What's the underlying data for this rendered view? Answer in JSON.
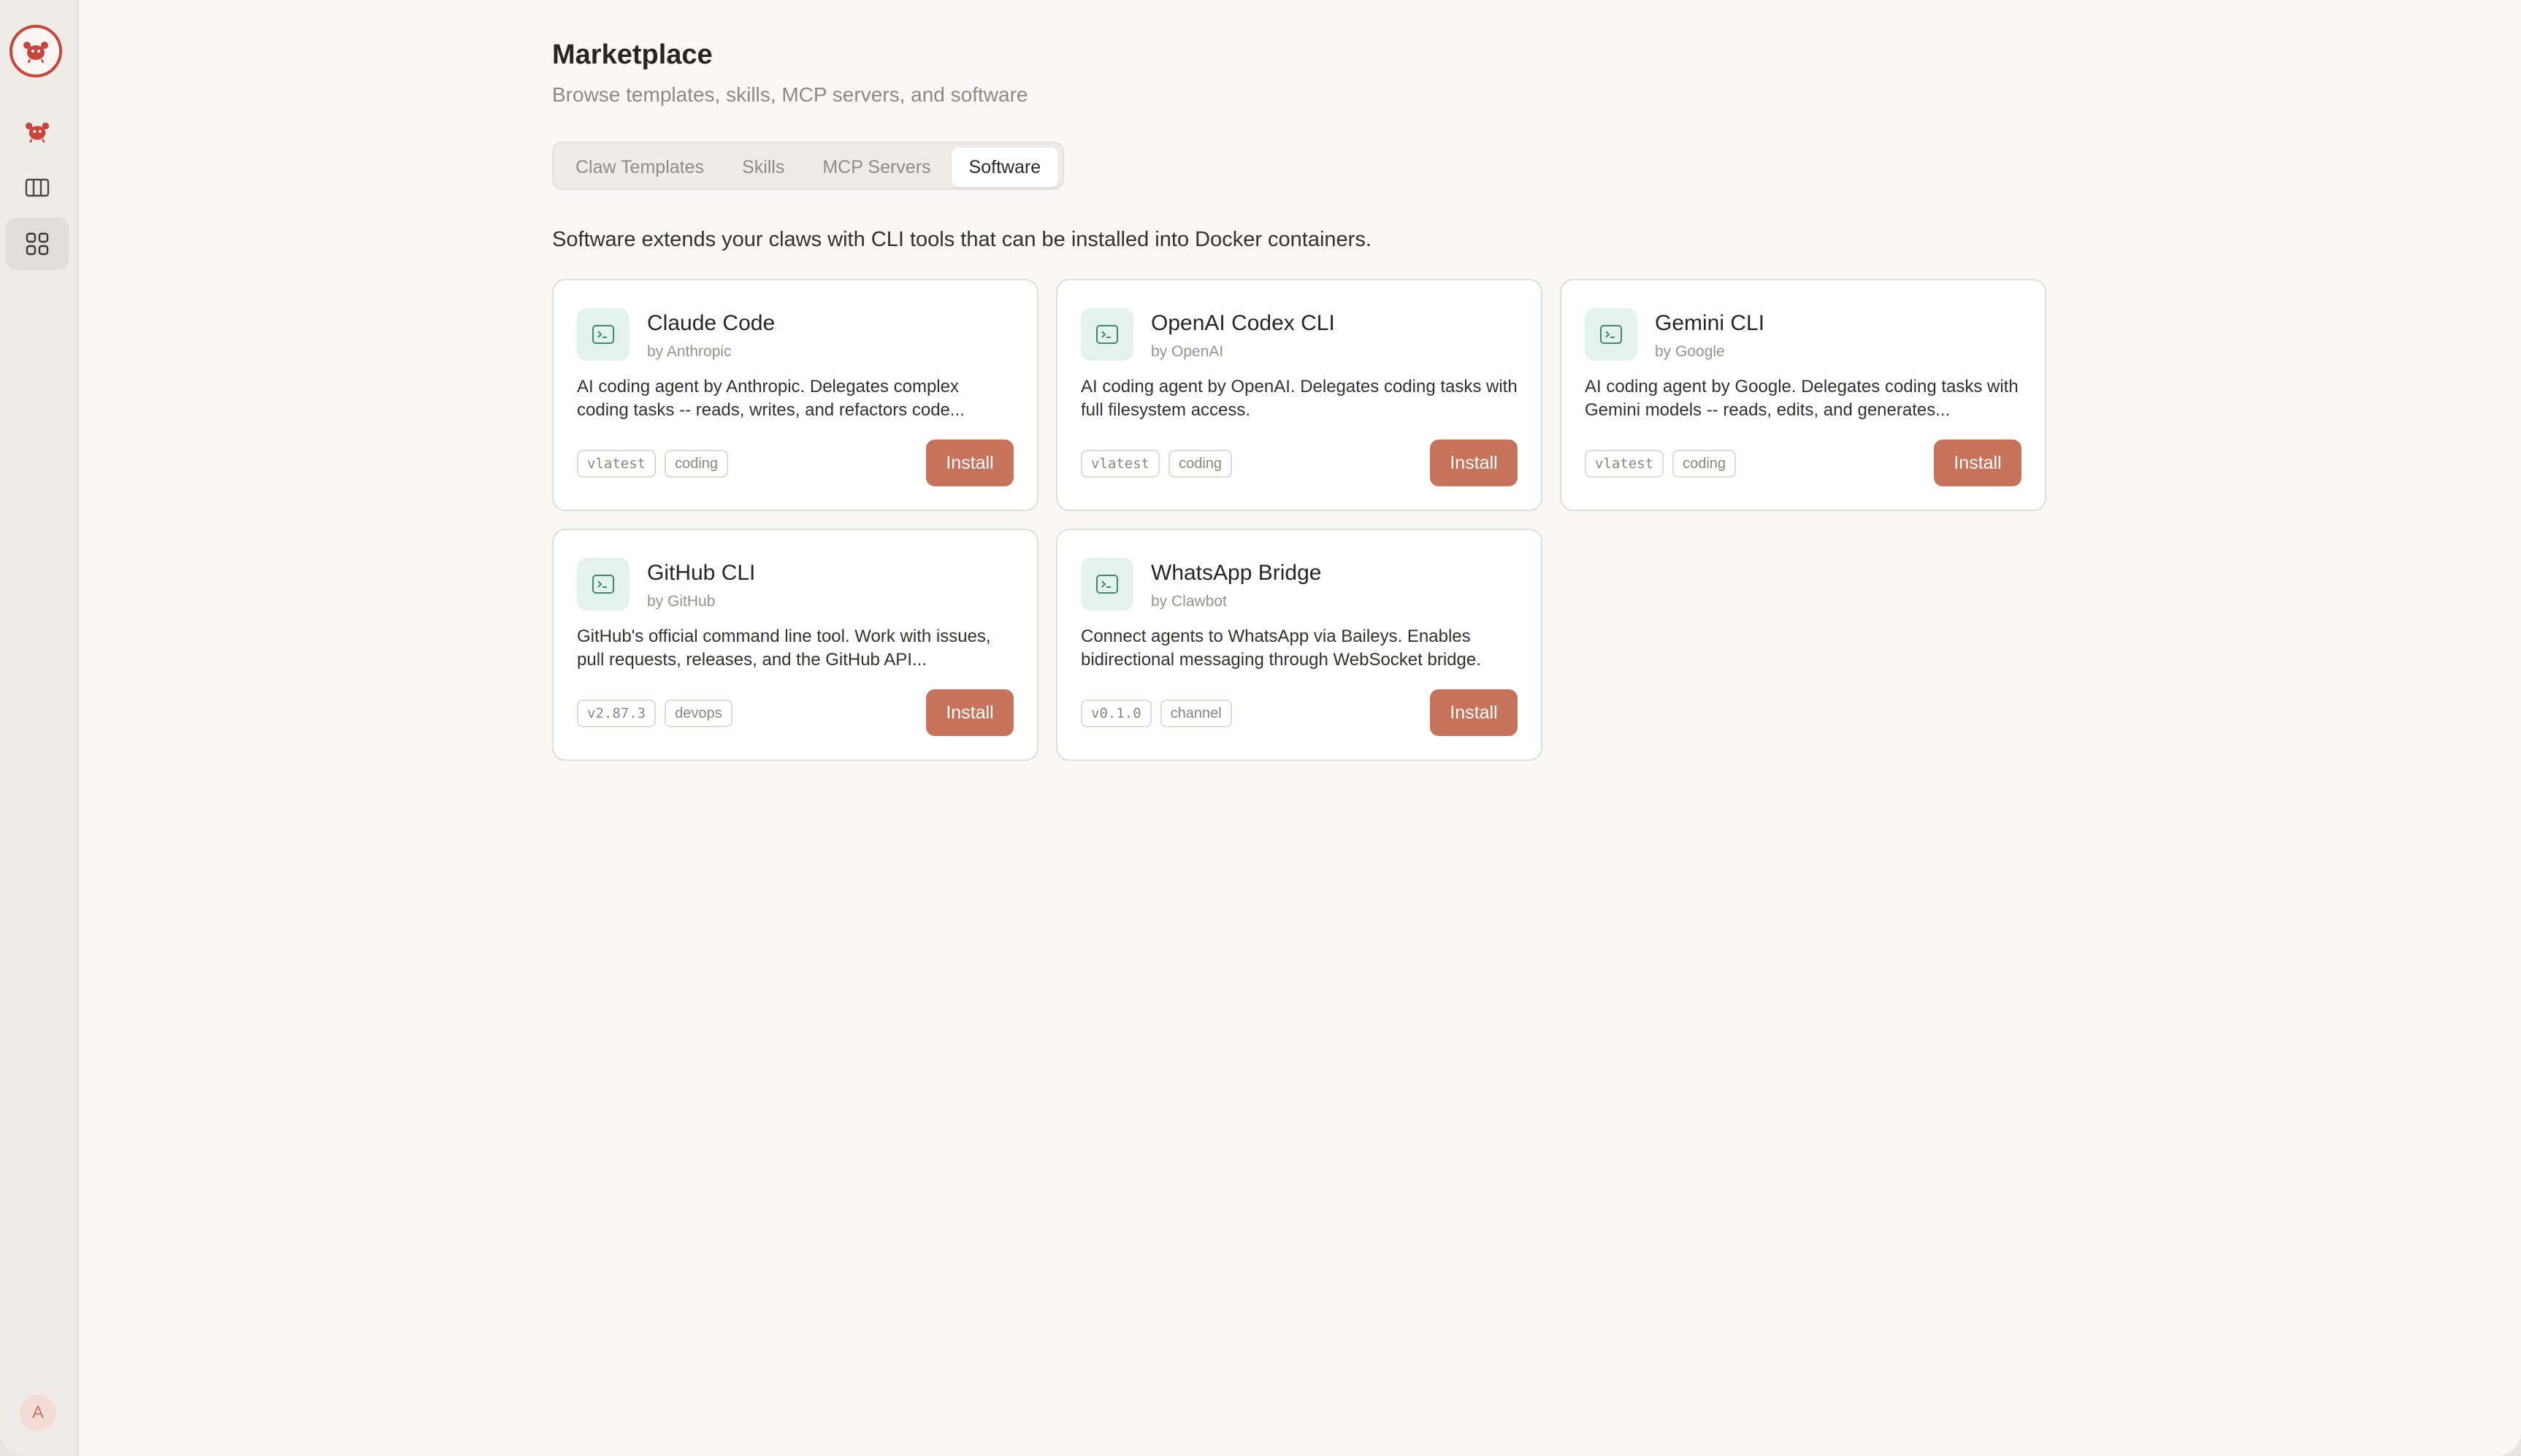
{
  "sidebar": {
    "items": [
      {
        "name": "claws",
        "icon": "claw-mascot-icon"
      },
      {
        "name": "board",
        "icon": "columns-icon"
      },
      {
        "name": "marketplace",
        "icon": "grid-icon",
        "active": true
      }
    ],
    "avatar_initial": "A"
  },
  "header": {
    "title": "Marketplace",
    "subtitle": "Browse templates, skills, MCP servers, and software"
  },
  "tabs": [
    {
      "label": "Claw Templates",
      "active": false
    },
    {
      "label": "Skills",
      "active": false
    },
    {
      "label": "MCP Servers",
      "active": false
    },
    {
      "label": "Software",
      "active": true
    }
  ],
  "intro": "Software extends your claws with CLI tools that can be installed into Docker containers.",
  "cards": [
    {
      "name": "Claude Code",
      "author": "by Anthropic",
      "description": "AI coding agent by Anthropic. Delegates complex coding tasks -- reads, writes, and refactors code...",
      "version": "vlatest",
      "category": "coding",
      "button": "Install"
    },
    {
      "name": "OpenAI Codex CLI",
      "author": "by OpenAI",
      "description": "AI coding agent by OpenAI. Delegates coding tasks with full filesystem access.",
      "version": "vlatest",
      "category": "coding",
      "button": "Install"
    },
    {
      "name": "Gemini CLI",
      "author": "by Google",
      "description": "AI coding agent by Google. Delegates coding tasks with Gemini models -- reads, edits, and generates...",
      "version": "vlatest",
      "category": "coding",
      "button": "Install"
    },
    {
      "name": "GitHub CLI",
      "author": "by GitHub",
      "description": "GitHub's official command line tool. Work with issues, pull requests, releases, and the GitHub API...",
      "version": "v2.87.3",
      "category": "devops",
      "button": "Install"
    },
    {
      "name": "WhatsApp Bridge",
      "author": "by Clawbot",
      "description": "Connect agents to WhatsApp via Baileys. Enables bidirectional messaging through WebSocket bridge.",
      "version": "v0.1.0",
      "category": "channel",
      "button": "Install"
    }
  ],
  "colors": {
    "accent": "#c7735c",
    "icon_bg": "#e3f2ec",
    "icon_fg": "#3e8a6f",
    "logo_ring": "#c8453b"
  }
}
